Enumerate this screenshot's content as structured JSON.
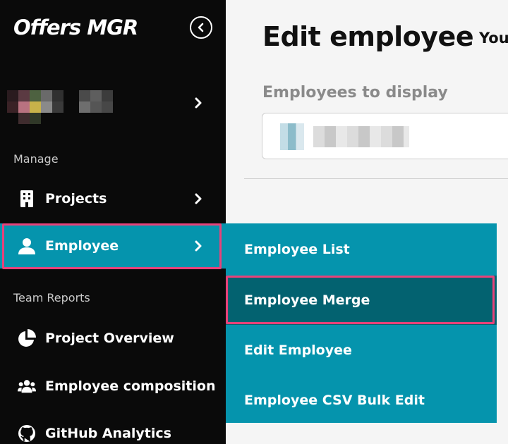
{
  "app": {
    "logo_text": "Offers MGR"
  },
  "sidebar": {
    "sections": {
      "manage": "Manage",
      "team_reports": "Team Reports"
    },
    "items": [
      {
        "label": "Projects",
        "icon": "building-icon"
      },
      {
        "label": "Employee",
        "icon": "user-icon",
        "active": true
      },
      {
        "label": "Project Overview",
        "icon": "pie-chart-icon"
      },
      {
        "label": "Employee composition",
        "icon": "users-icon"
      },
      {
        "label": "GitHub Analytics",
        "icon": "github-icon"
      }
    ]
  },
  "submenu": {
    "items": [
      {
        "label": "Employee List"
      },
      {
        "label": "Employee Merge",
        "selected": true
      },
      {
        "label": "Edit Employee"
      },
      {
        "label": "Employee CSV Bulk Edit"
      }
    ]
  },
  "main": {
    "title": "Edit employee",
    "note": "You",
    "employees_field_label": "Employees to display"
  },
  "colors": {
    "sidebar_bg": "#0a0a0a",
    "accent": "#0594ad",
    "accent_dark": "#036270",
    "highlight": "#e8427a"
  }
}
